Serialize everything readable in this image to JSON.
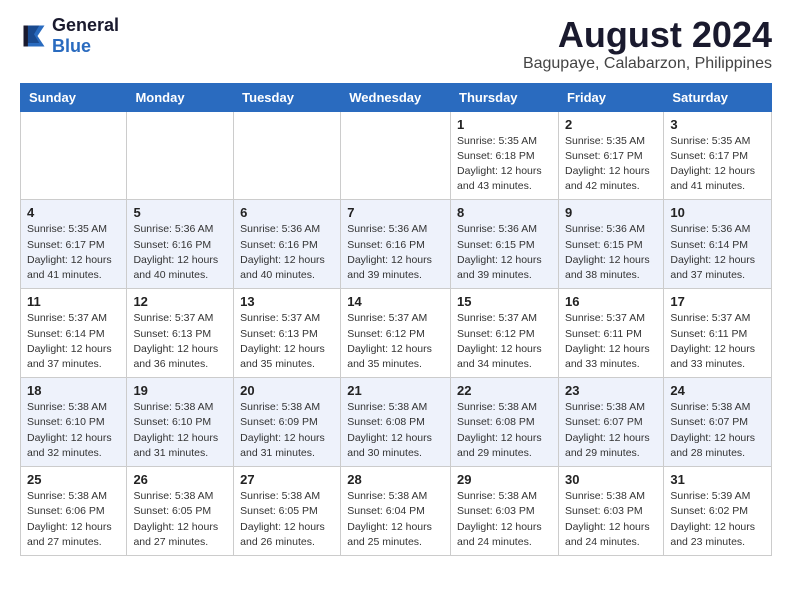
{
  "header": {
    "logo": {
      "text_general": "General",
      "text_blue": "Blue",
      "logo_alt": "GeneralBlue logo"
    },
    "title": "August 2024",
    "subtitle": "Bagupaye, Calabarzon, Philippines"
  },
  "calendar": {
    "days_of_week": [
      "Sunday",
      "Monday",
      "Tuesday",
      "Wednesday",
      "Thursday",
      "Friday",
      "Saturday"
    ],
    "weeks": [
      {
        "days": [
          {
            "num": "",
            "detail": ""
          },
          {
            "num": "",
            "detail": ""
          },
          {
            "num": "",
            "detail": ""
          },
          {
            "num": "",
            "detail": ""
          },
          {
            "num": "1",
            "detail": "Sunrise: 5:35 AM\nSunset: 6:18 PM\nDaylight: 12 hours\nand 43 minutes."
          },
          {
            "num": "2",
            "detail": "Sunrise: 5:35 AM\nSunset: 6:17 PM\nDaylight: 12 hours\nand 42 minutes."
          },
          {
            "num": "3",
            "detail": "Sunrise: 5:35 AM\nSunset: 6:17 PM\nDaylight: 12 hours\nand 41 minutes."
          }
        ]
      },
      {
        "days": [
          {
            "num": "4",
            "detail": "Sunrise: 5:35 AM\nSunset: 6:17 PM\nDaylight: 12 hours\nand 41 minutes."
          },
          {
            "num": "5",
            "detail": "Sunrise: 5:36 AM\nSunset: 6:16 PM\nDaylight: 12 hours\nand 40 minutes."
          },
          {
            "num": "6",
            "detail": "Sunrise: 5:36 AM\nSunset: 6:16 PM\nDaylight: 12 hours\nand 40 minutes."
          },
          {
            "num": "7",
            "detail": "Sunrise: 5:36 AM\nSunset: 6:16 PM\nDaylight: 12 hours\nand 39 minutes."
          },
          {
            "num": "8",
            "detail": "Sunrise: 5:36 AM\nSunset: 6:15 PM\nDaylight: 12 hours\nand 39 minutes."
          },
          {
            "num": "9",
            "detail": "Sunrise: 5:36 AM\nSunset: 6:15 PM\nDaylight: 12 hours\nand 38 minutes."
          },
          {
            "num": "10",
            "detail": "Sunrise: 5:36 AM\nSunset: 6:14 PM\nDaylight: 12 hours\nand 37 minutes."
          }
        ]
      },
      {
        "days": [
          {
            "num": "11",
            "detail": "Sunrise: 5:37 AM\nSunset: 6:14 PM\nDaylight: 12 hours\nand 37 minutes."
          },
          {
            "num": "12",
            "detail": "Sunrise: 5:37 AM\nSunset: 6:13 PM\nDaylight: 12 hours\nand 36 minutes."
          },
          {
            "num": "13",
            "detail": "Sunrise: 5:37 AM\nSunset: 6:13 PM\nDaylight: 12 hours\nand 35 minutes."
          },
          {
            "num": "14",
            "detail": "Sunrise: 5:37 AM\nSunset: 6:12 PM\nDaylight: 12 hours\nand 35 minutes."
          },
          {
            "num": "15",
            "detail": "Sunrise: 5:37 AM\nSunset: 6:12 PM\nDaylight: 12 hours\nand 34 minutes."
          },
          {
            "num": "16",
            "detail": "Sunrise: 5:37 AM\nSunset: 6:11 PM\nDaylight: 12 hours\nand 33 minutes."
          },
          {
            "num": "17",
            "detail": "Sunrise: 5:37 AM\nSunset: 6:11 PM\nDaylight: 12 hours\nand 33 minutes."
          }
        ]
      },
      {
        "days": [
          {
            "num": "18",
            "detail": "Sunrise: 5:38 AM\nSunset: 6:10 PM\nDaylight: 12 hours\nand 32 minutes."
          },
          {
            "num": "19",
            "detail": "Sunrise: 5:38 AM\nSunset: 6:10 PM\nDaylight: 12 hours\nand 31 minutes."
          },
          {
            "num": "20",
            "detail": "Sunrise: 5:38 AM\nSunset: 6:09 PM\nDaylight: 12 hours\nand 31 minutes."
          },
          {
            "num": "21",
            "detail": "Sunrise: 5:38 AM\nSunset: 6:08 PM\nDaylight: 12 hours\nand 30 minutes."
          },
          {
            "num": "22",
            "detail": "Sunrise: 5:38 AM\nSunset: 6:08 PM\nDaylight: 12 hours\nand 29 minutes."
          },
          {
            "num": "23",
            "detail": "Sunrise: 5:38 AM\nSunset: 6:07 PM\nDaylight: 12 hours\nand 29 minutes."
          },
          {
            "num": "24",
            "detail": "Sunrise: 5:38 AM\nSunset: 6:07 PM\nDaylight: 12 hours\nand 28 minutes."
          }
        ]
      },
      {
        "days": [
          {
            "num": "25",
            "detail": "Sunrise: 5:38 AM\nSunset: 6:06 PM\nDaylight: 12 hours\nand 27 minutes."
          },
          {
            "num": "26",
            "detail": "Sunrise: 5:38 AM\nSunset: 6:05 PM\nDaylight: 12 hours\nand 27 minutes."
          },
          {
            "num": "27",
            "detail": "Sunrise: 5:38 AM\nSunset: 6:05 PM\nDaylight: 12 hours\nand 26 minutes."
          },
          {
            "num": "28",
            "detail": "Sunrise: 5:38 AM\nSunset: 6:04 PM\nDaylight: 12 hours\nand 25 minutes."
          },
          {
            "num": "29",
            "detail": "Sunrise: 5:38 AM\nSunset: 6:03 PM\nDaylight: 12 hours\nand 24 minutes."
          },
          {
            "num": "30",
            "detail": "Sunrise: 5:38 AM\nSunset: 6:03 PM\nDaylight: 12 hours\nand 24 minutes."
          },
          {
            "num": "31",
            "detail": "Sunrise: 5:39 AM\nSunset: 6:02 PM\nDaylight: 12 hours\nand 23 minutes."
          }
        ]
      }
    ]
  }
}
